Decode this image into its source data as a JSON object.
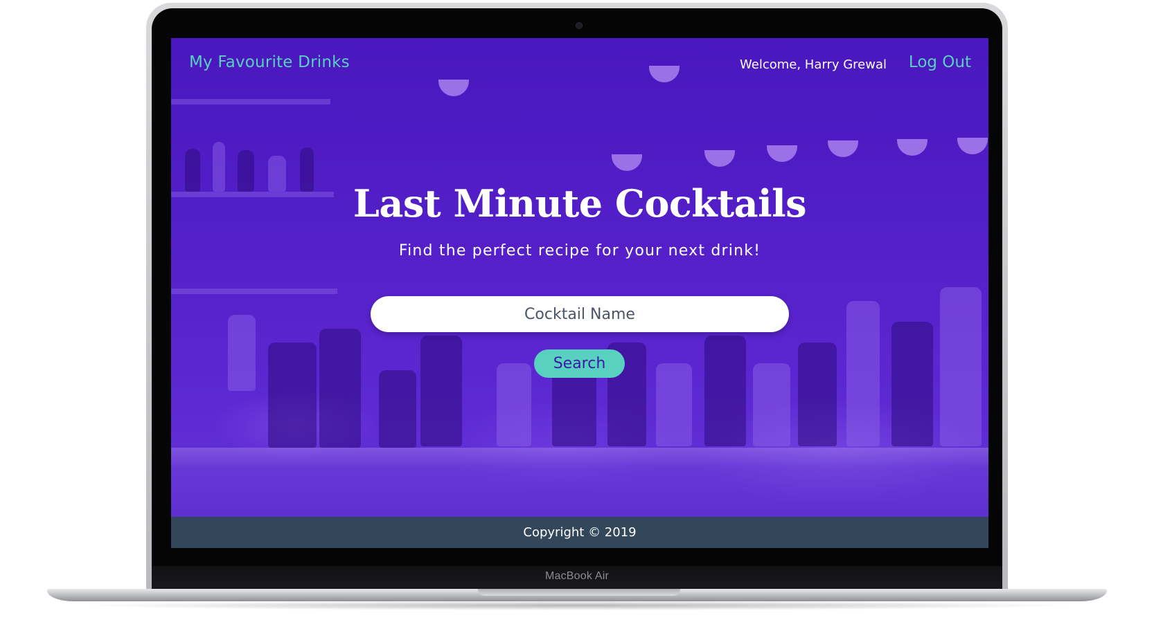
{
  "device": {
    "label": "MacBook Air"
  },
  "nav": {
    "brand": "My Favourite Drinks",
    "welcome": "Welcome, Harry Grewal",
    "logout": "Log Out"
  },
  "hero": {
    "title": "Last Minute Cocktails",
    "subtitle": "Find the perfect recipe for your next drink!",
    "search_placeholder": "Cocktail Name",
    "search_button": "Search"
  },
  "footer": {
    "copyright": "Copyright © 2019"
  },
  "colors": {
    "accent": "#58d1c1",
    "hero_overlay": "#4a17bd",
    "footer_bg": "#33475b",
    "button_text": "#3b1aa3"
  },
  "icons": []
}
